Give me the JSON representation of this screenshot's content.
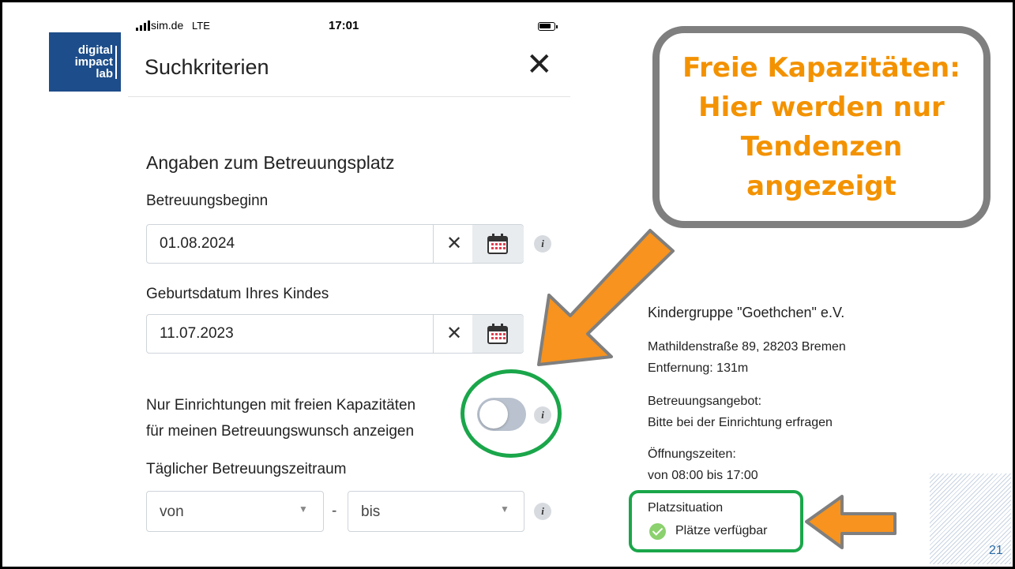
{
  "logo": {
    "line1": "digital",
    "line2": "impact",
    "line3": "lab"
  },
  "status_bar": {
    "carrier": "sim.de",
    "network": "LTE",
    "time": "17:01"
  },
  "header": {
    "title": "Suchkriterien",
    "close_symbol": "✕"
  },
  "form": {
    "section_title": "Angaben zum Betreuungsplatz",
    "start_label": "Betreuungsbeginn",
    "start_value": "01.08.2024",
    "birth_label": "Geburtsdatum Ihres Kindes",
    "birth_value": "11.07.2023",
    "clear_symbol": "✕",
    "info_symbol": "i",
    "toggle_line1": "Nur Einrichtungen mit freien Kapazitäten",
    "toggle_line2": "für meinen Betreuungswunsch anzeigen",
    "toggle_on": false,
    "period_label": "Täglicher Betreuungszeitraum",
    "from_placeholder": "von",
    "dash": "-",
    "to_placeholder": "bis"
  },
  "callout": {
    "line1": "Freie Kapazitäten:",
    "line2": "Hier werden nur",
    "line3": "Tendenzen",
    "line4": "angezeigt"
  },
  "facility": {
    "name": "Kindergruppe \"Goethchen\" e.V.",
    "address": "Mathildenstraße 89, 28203 Bremen",
    "distance": "Entfernung: 131m",
    "offer_label": "Betreuungsangebot:",
    "offer_value": "Bitte bei der Einrichtung erfragen",
    "hours_label": "Öffnungszeiten:",
    "hours_value": "von 08:00  bis 17:00",
    "place_label": "Platzsituation",
    "place_value": "Plätze verfügbar"
  },
  "colors": {
    "accent_orange": "#f39200",
    "highlight_green": "#1aa64a",
    "callout_border": "#7f7f7f",
    "logo_blue": "#1d4d8a"
  },
  "slide": {
    "page_number": "21"
  }
}
